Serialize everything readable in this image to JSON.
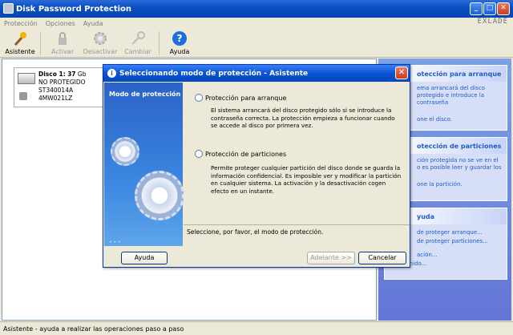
{
  "window": {
    "title": "Disk Password Protection",
    "controls": [
      "_",
      "□",
      "✕"
    ]
  },
  "menu": [
    "Protección",
    "Opciones",
    "Ayuda"
  ],
  "brand": "EXLADE",
  "toolbar": {
    "asistente": "Asistente",
    "activar": "Activar",
    "desactivar": "Desactivar",
    "cambiar": "Cambiar",
    "ayuda": "Ayuda"
  },
  "disk": {
    "name": "Disco 1:",
    "size": "37",
    "unit": "Gb",
    "status": "NO PROTEGIDO",
    "model": "ST340014A",
    "serial": "4MW021LZ"
  },
  "taskpane": {
    "box1": {
      "title": "otección para arranque",
      "text": "ema arrancará del disco protegido e introduce la contraseña",
      "link": "one el disco."
    },
    "box2": {
      "title": "otección de particiones",
      "text": "ción protegida no se ve en el o es posible leer y guardar los",
      "link": "one la partición."
    },
    "box3": {
      "title": "yuda",
      "links": [
        "de proteger arranque...",
        "de proteger particiones...",
        "ación...",
        "Contenido..."
      ]
    }
  },
  "status": "Asistente - ayuda a realizar las operaciones paso a paso",
  "dialog": {
    "title": "Seleccionando modo de protección - Asistente",
    "close": "✕",
    "left_title": "Modo de protección",
    "dots": "• • •",
    "option1": {
      "label": "Protección para arranque",
      "desc": "El sistema arrancará del disco protegido sólo si se introduce la contraseña correcta. La protección empieza a funcionar cuando se accede al disco por primera vez."
    },
    "option2": {
      "label": "Protección de particiones",
      "desc": "Permite proteger cualquier partición del disco donde se guarda la información confidencial. Es imposible ver y modificar la partición en cualquier sistema. La activación y la desactivación cogen efecto en un instante."
    },
    "prompt": "Seleccione, por favor, el modo de protección.",
    "buttons": {
      "help": "Ayuda",
      "next": "Adelante >>",
      "cancel": "Cancelar"
    }
  }
}
